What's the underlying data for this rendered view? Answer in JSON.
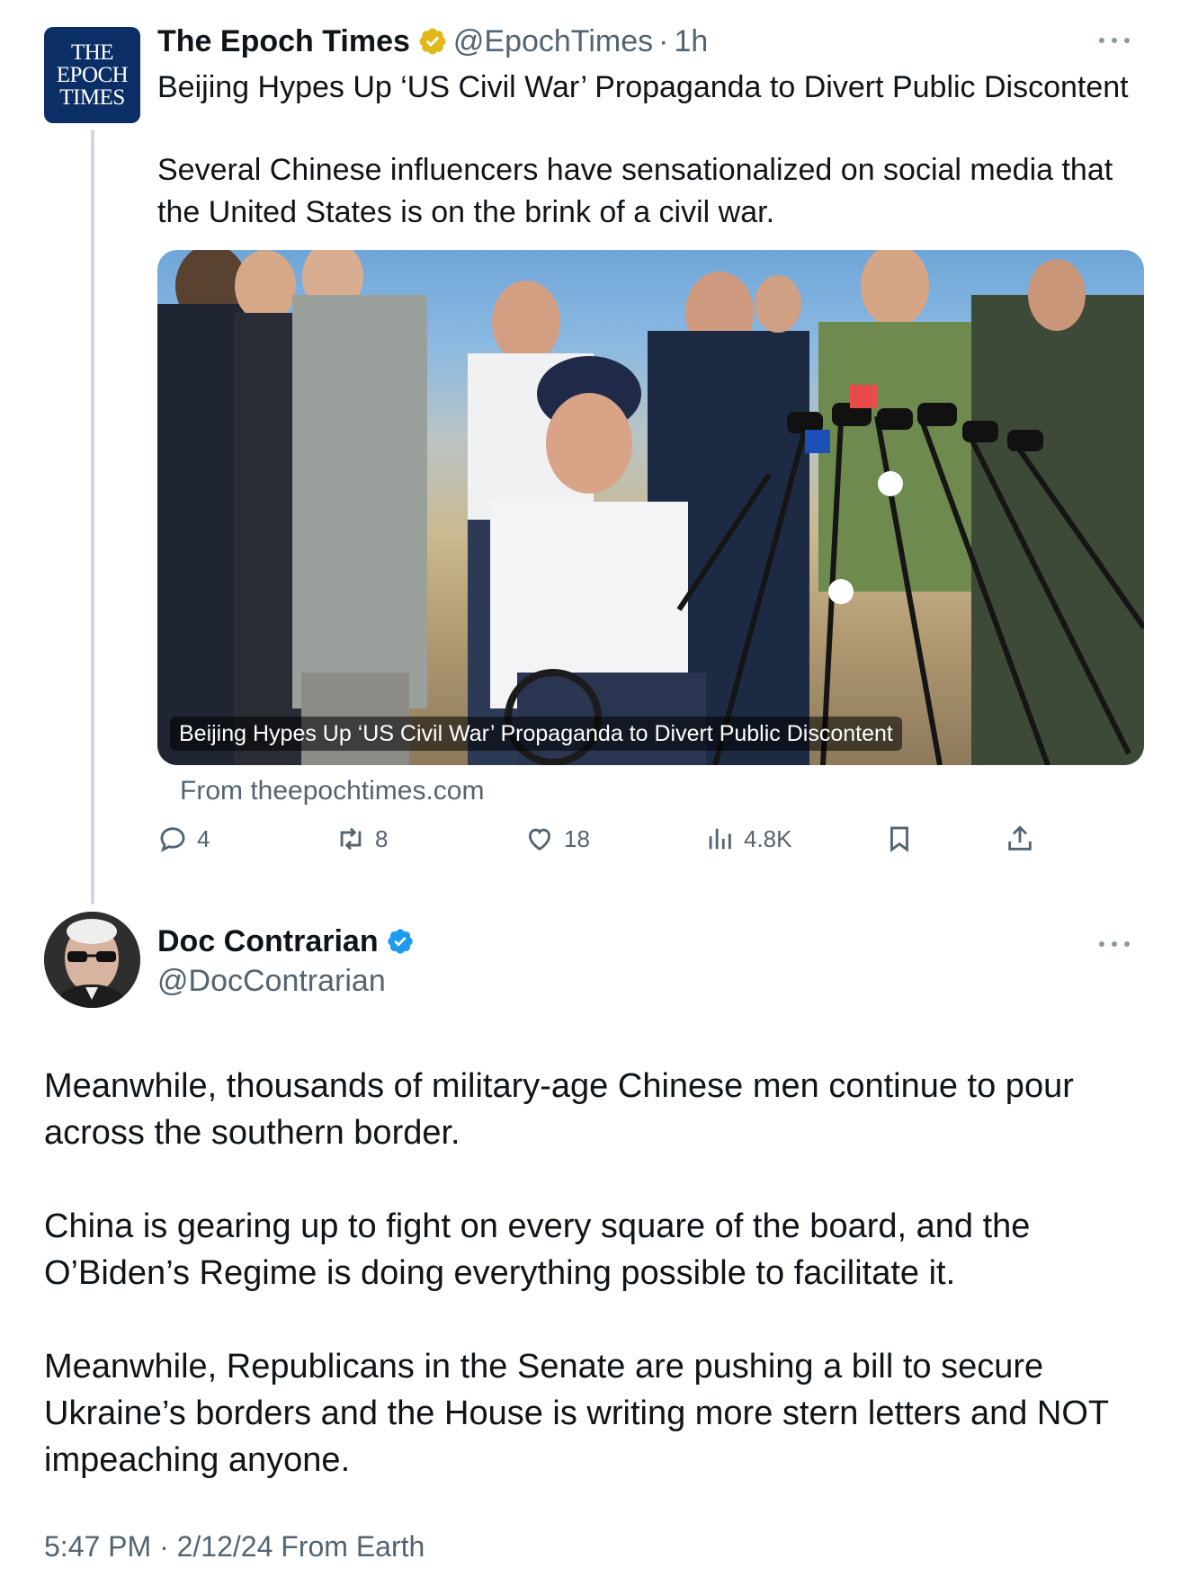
{
  "parent_tweet": {
    "avatar_text": [
      "THE",
      "EPOCH",
      "TIMES"
    ],
    "display_name": "The Epoch Times",
    "verified_badge": "gold-check-badge-icon",
    "handle": "@EpochTimes",
    "separator": "·",
    "time": "1h",
    "headline": "Beijing Hypes Up ‘US Civil War’ Propaganda to Divert Public Discontent",
    "body": "Several Chinese influencers have sensationalized on social media that the United States is on the brink of a civil war.",
    "card": {
      "caption": "Beijing Hypes Up ‘US Civil War’ Propaganda to Divert Public Discontent",
      "source": "From theepochtimes.com"
    },
    "actions": {
      "replies": "4",
      "retweets": "8",
      "likes": "18",
      "views": "4.8K"
    }
  },
  "main_tweet": {
    "display_name": "Doc Contrarian",
    "verified_badge": "blue-check-badge-icon",
    "handle": "@DocContrarian",
    "paragraphs": [
      "Meanwhile, thousands of military-age Chinese men continue to pour across the southern border.",
      "China is gearing up to fight on every square of the board, and the O’Biden’s Regime is doing everything possible to facilitate it.",
      "Meanwhile, Republicans in the Senate are pushing a bill to secure Ukraine’s borders and the House is writing more stern letters and NOT impeaching anyone."
    ],
    "timestamp": "5:47 PM · 2/12/24 From Earth"
  },
  "colors": {
    "text": "#0f1419",
    "secondary": "#536471",
    "gold_badge": "#e2b719",
    "blue_badge": "#1d9bf0",
    "epoch_blue": "#0b2e66",
    "thread_line": "#cfd9de"
  }
}
